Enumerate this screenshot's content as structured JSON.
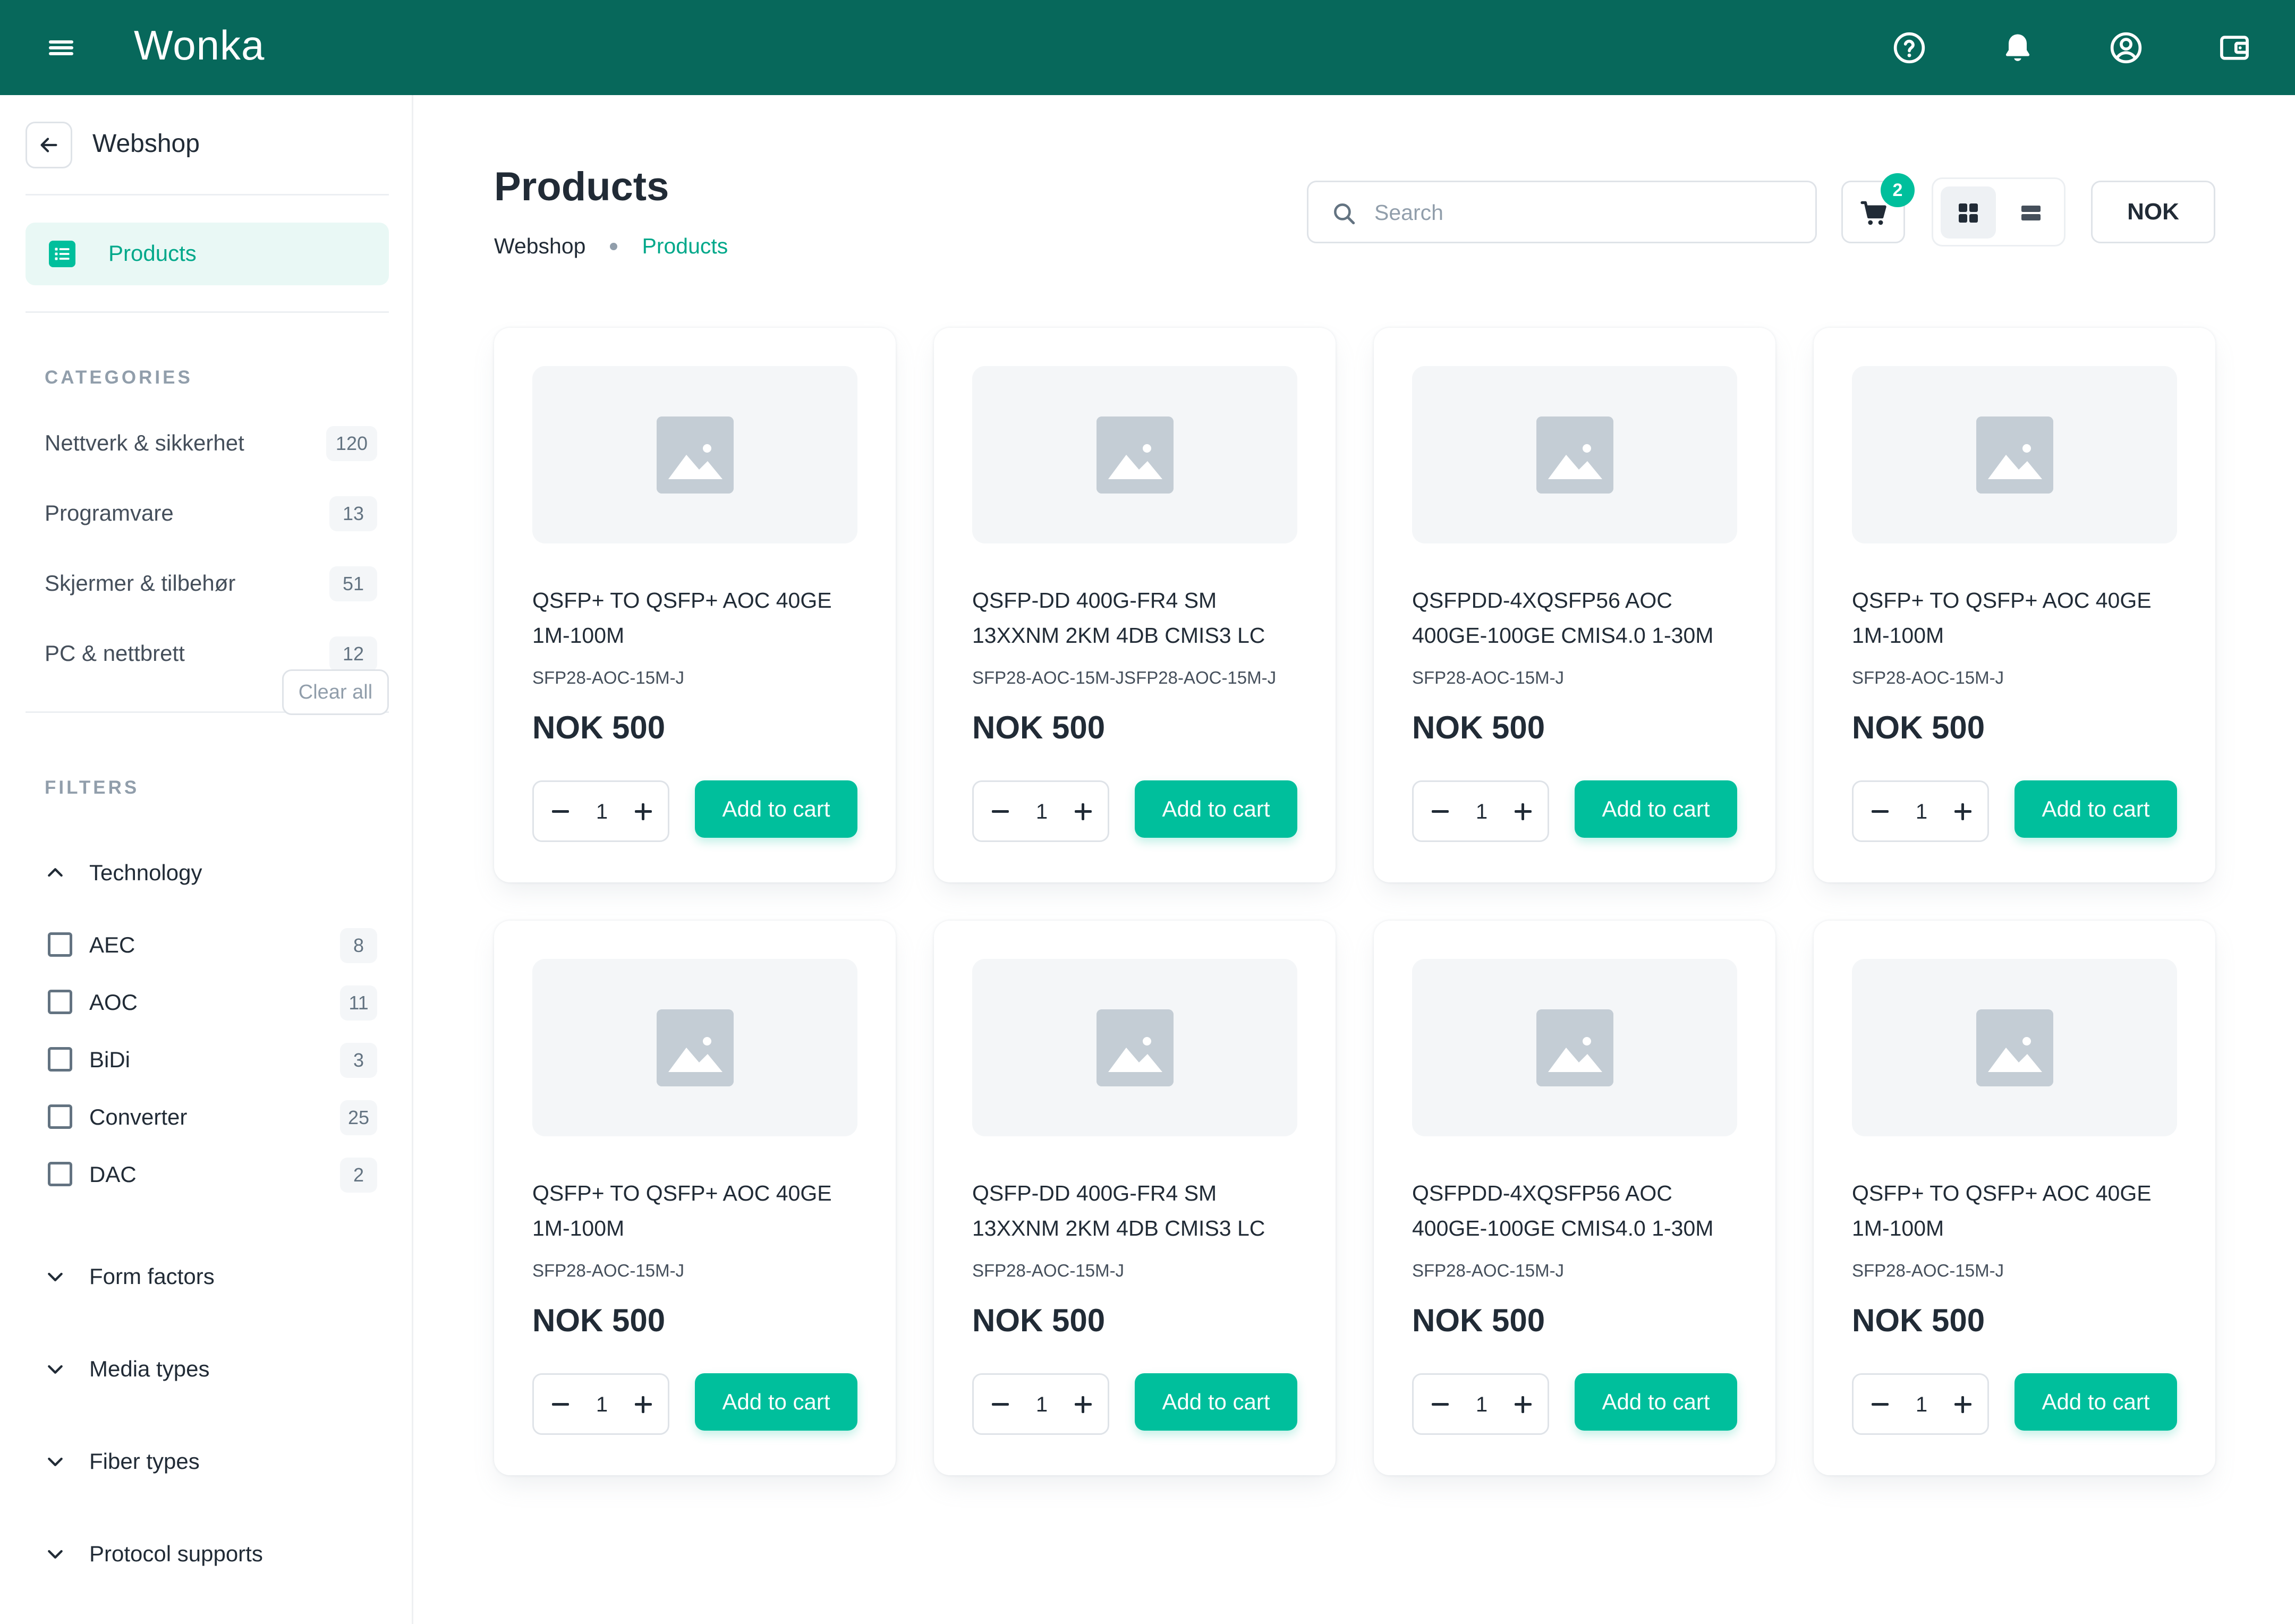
{
  "app": {
    "brand": "Wonka",
    "accent": "#00bf9c",
    "topbar_color": "#07685b",
    "icons": [
      "menu-icon",
      "help-icon",
      "bell-icon",
      "account-icon",
      "wallet-icon"
    ]
  },
  "sidebar": {
    "title": "Webshop",
    "nav_item": "Products",
    "categories_label": "CATEGORIES",
    "categories": [
      {
        "label": "Nettverk & sikkerhet",
        "count": "120"
      },
      {
        "label": "Programvare",
        "count": "13"
      },
      {
        "label": "Skjermer & tilbehør",
        "count": "51"
      },
      {
        "label": "PC & nettbrett",
        "count": "12"
      }
    ],
    "filters_label": "FILTERS",
    "clear_all": "Clear all",
    "technology": {
      "label": "Technology",
      "options": [
        {
          "label": "AEC",
          "count": "8"
        },
        {
          "label": "AOC",
          "count": "11"
        },
        {
          "label": "BiDi",
          "count": "3"
        },
        {
          "label": "Converter",
          "count": "25"
        },
        {
          "label": "DAC",
          "count": "2"
        }
      ]
    },
    "groups": [
      "Form factors",
      "Media types",
      "Fiber types",
      "Protocol supports"
    ]
  },
  "header": {
    "title": "Products",
    "breadcrumb": [
      "Webshop",
      "Products"
    ],
    "search_placeholder": "Search",
    "cart_count": "2",
    "currency": "NOK"
  },
  "products": [
    {
      "name_line1": "QSFP+ TO QSFP+ AOC 40GE",
      "name_line2": "1M-100M",
      "sku": "SFP28-AOC-15M-J",
      "price": "NOK 500",
      "qty": "1",
      "add_label": "Add to cart"
    },
    {
      "name_line1": "QSFP-DD 400G-FR4 SM",
      "name_line2": "13XXNM 2KM 4DB CMIS3 LC",
      "sku": "SFP28-AOC-15M-JSFP28-AOC-15M-J",
      "price": "NOK 500",
      "qty": "1",
      "add_label": "Add to cart"
    },
    {
      "name_line1": "QSFPDD-4XQSFP56 AOC",
      "name_line2": "400GE-100GE CMIS4.0 1-30M",
      "sku": "SFP28-AOC-15M-J",
      "price": "NOK 500",
      "qty": "1",
      "add_label": "Add to cart"
    },
    {
      "name_line1": "QSFP+ TO QSFP+ AOC 40GE",
      "name_line2": "1M-100M",
      "sku": "SFP28-AOC-15M-J",
      "price": "NOK 500",
      "qty": "1",
      "add_label": "Add to cart"
    },
    {
      "name_line1": "QSFP+ TO QSFP+ AOC 40GE",
      "name_line2": "1M-100M",
      "sku": "SFP28-AOC-15M-J",
      "price": "NOK 500",
      "qty": "1",
      "add_label": "Add to cart"
    },
    {
      "name_line1": "QSFP-DD 400G-FR4 SM",
      "name_line2": "13XXNM 2KM 4DB CMIS3 LC",
      "sku": "SFP28-AOC-15M-J",
      "price": "NOK 500",
      "qty": "1",
      "add_label": "Add to cart"
    },
    {
      "name_line1": "QSFPDD-4XQSFP56 AOC",
      "name_line2": "400GE-100GE CMIS4.0 1-30M",
      "sku": "SFP28-AOC-15M-J",
      "price": "NOK 500",
      "qty": "1",
      "add_label": "Add to cart"
    },
    {
      "name_line1": "QSFP+ TO QSFP+ AOC 40GE",
      "name_line2": "1M-100M",
      "sku": "SFP28-AOC-15M-J",
      "price": "NOK 500",
      "qty": "1",
      "add_label": "Add to cart"
    }
  ]
}
